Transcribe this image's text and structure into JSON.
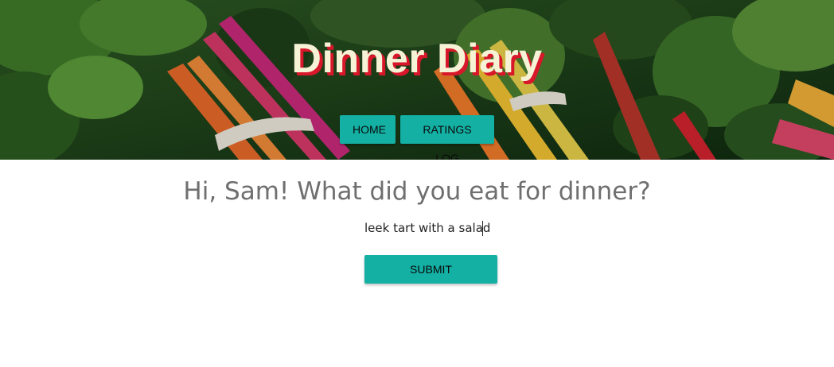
{
  "header": {
    "title": "Dinner Diary",
    "nav": [
      {
        "label": "HOME"
      },
      {
        "label": "RATINGS LOG"
      }
    ]
  },
  "main": {
    "greeting": "Hi, Sam! What did you eat for dinner?",
    "dinner_input": {
      "value": "leek tart with a salad"
    },
    "submit_label": "SUBMIT"
  },
  "colors": {
    "accent": "#13b0a3",
    "title_text": "#f6f2d6",
    "title_shadow": "#d8172a",
    "greeting_text": "#6f6f6f"
  }
}
